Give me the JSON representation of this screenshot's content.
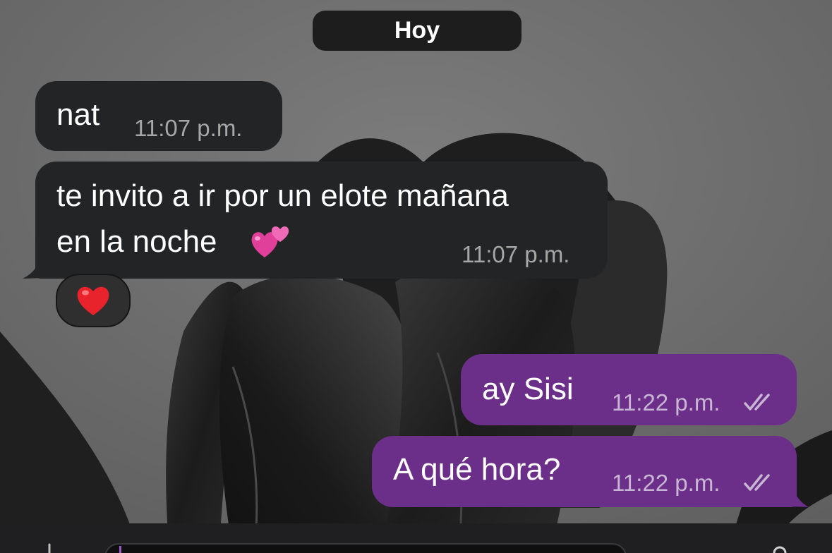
{
  "date_separator": "Hoy",
  "messages": [
    {
      "direction": "incoming",
      "text": "nat",
      "time": "11:07 p.m."
    },
    {
      "direction": "incoming",
      "line1": "te invito a ir por un elote mañana",
      "line2": "en la noche",
      "emoji": "two-hearts",
      "time": "11:07 p.m.",
      "reaction": "red-heart"
    },
    {
      "direction": "outgoing",
      "text": "ay Sisi",
      "time": "11:22 p.m.",
      "status": "read-double-check"
    },
    {
      "direction": "outgoing",
      "text": "A qué hora?",
      "time": "11:22 p.m.",
      "status": "read-double-check"
    }
  ],
  "colors": {
    "background": "#6f6f6f",
    "incoming_bubble": "#232425",
    "outgoing_bubble": "#6b2f8a",
    "date_pill": "#1d1d1d"
  }
}
